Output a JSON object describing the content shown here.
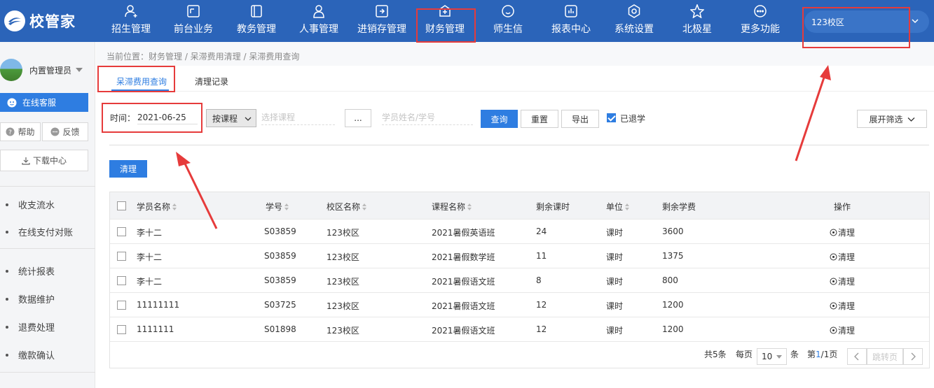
{
  "app": {
    "name": "校管家"
  },
  "nav": {
    "items": [
      {
        "label": "招生管理",
        "icon": "user-add-icon"
      },
      {
        "label": "前台业务",
        "icon": "monitor-icon"
      },
      {
        "label": "教务管理",
        "icon": "book-icon"
      },
      {
        "label": "人事管理",
        "icon": "person-icon"
      },
      {
        "label": "进销存管理",
        "icon": "inventory-icon"
      },
      {
        "label": "财务管理",
        "icon": "finance-icon"
      },
      {
        "label": "师生信",
        "icon": "chat-icon"
      },
      {
        "label": "报表中心",
        "icon": "report-icon"
      },
      {
        "label": "系统设置",
        "icon": "settings-icon"
      },
      {
        "label": "北极星",
        "icon": "star-icon"
      },
      {
        "label": "更多功能",
        "icon": "more-icon"
      }
    ],
    "active_index": 5
  },
  "campus_select": {
    "value": "123校区"
  },
  "sidebar": {
    "user": "内置管理员",
    "service_label": "在线客服",
    "help_label": "帮助",
    "feedback_label": "反馈",
    "download_label": "下载中心",
    "menu_group1": [
      "收支流水",
      "在线支付对账"
    ],
    "menu_group2": [
      "统计报表",
      "数据维护",
      "退费处理",
      "缴款确认"
    ]
  },
  "breadcrumb": "当前位置：财务管理 / 呆滞费用清理 / 呆滞费用查询",
  "tabs": [
    {
      "label": "呆滞费用查询",
      "active": true
    },
    {
      "label": "清理记录",
      "active": false
    }
  ],
  "filters": {
    "time_label": "时间：",
    "date_value": "2021-06-25",
    "mode_value": "按课程",
    "course_placeholder": "选择课程",
    "ellipsis_label": "...",
    "student_placeholder": "学员姓名/学号",
    "query_label": "查询",
    "reset_label": "重置",
    "export_label": "导出",
    "withdrawn_label": "已退学",
    "withdrawn_checked": true,
    "expand_label": "展开筛选"
  },
  "clean_button": "清理",
  "table": {
    "headers": [
      "学员名称",
      "学号",
      "校区名称",
      "课程名称",
      "剩余课时",
      "单位",
      "剩余学费",
      "操作"
    ],
    "rows": [
      [
        "李十二",
        "S03859",
        "123校区",
        "2021暑假英语班",
        "24",
        "课时",
        "3600",
        "清理"
      ],
      [
        "李十二",
        "S03859",
        "123校区",
        "2021暑假数学班",
        "11",
        "课时",
        "1375",
        "清理"
      ],
      [
        "李十二",
        "S03859",
        "123校区",
        "2021暑假语文班",
        "8",
        "课时",
        "800",
        "清理"
      ],
      [
        "11111111",
        "S03725",
        "123校区",
        "2021暑假语文班",
        "12",
        "课时",
        "1200",
        "清理"
      ],
      [
        "1111111",
        "S01898",
        "123校区",
        "2021暑假语文班",
        "12",
        "课时",
        "1200",
        "清理"
      ]
    ]
  },
  "pagination": {
    "total": "共5条",
    "per_page_label": "每页",
    "per_page_value": "10",
    "unit_label": "条",
    "page_prefix": "第",
    "page_current": "1",
    "page_suffix": "/1页",
    "jump_label": "跳转页"
  },
  "colors": {
    "nav_bg": "#2b64b9",
    "accent": "#2e7de1",
    "annotation": "#e63b3b"
  }
}
